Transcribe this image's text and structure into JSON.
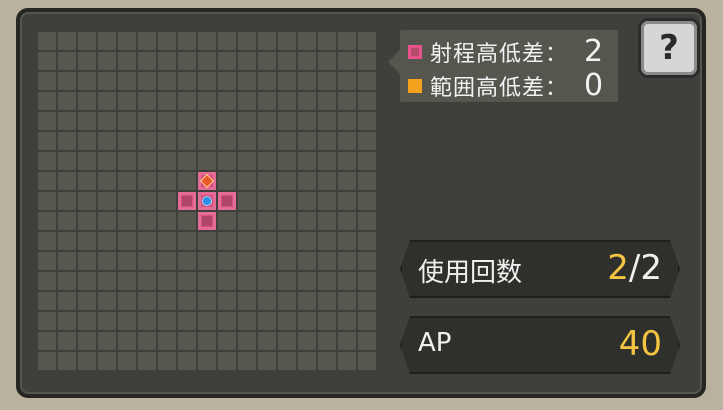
{
  "legend": {
    "range_height_label": "射程高低差：",
    "range_height_value": "2",
    "area_height_label": "範囲高低差：",
    "area_height_value": "0"
  },
  "help": {
    "label": "?"
  },
  "uses": {
    "label": "使用回数",
    "current": "2",
    "separator": "/",
    "max": "2"
  },
  "ap": {
    "label": "AP",
    "value": "40"
  },
  "grid": {
    "cols": 17,
    "rows": 17,
    "highlighted": [
      {
        "col": 8,
        "row": 7,
        "kind": "top-marker"
      },
      {
        "col": 7,
        "row": 8,
        "kind": "range"
      },
      {
        "col": 8,
        "row": 8,
        "kind": "origin"
      },
      {
        "col": 9,
        "row": 8,
        "kind": "range"
      },
      {
        "col": 8,
        "row": 9,
        "kind": "range"
      }
    ]
  },
  "colors": {
    "range": "#d7507f",
    "area": "#f4a21e",
    "origin": "#2b8fe6",
    "value_gold": "#f3c542"
  }
}
